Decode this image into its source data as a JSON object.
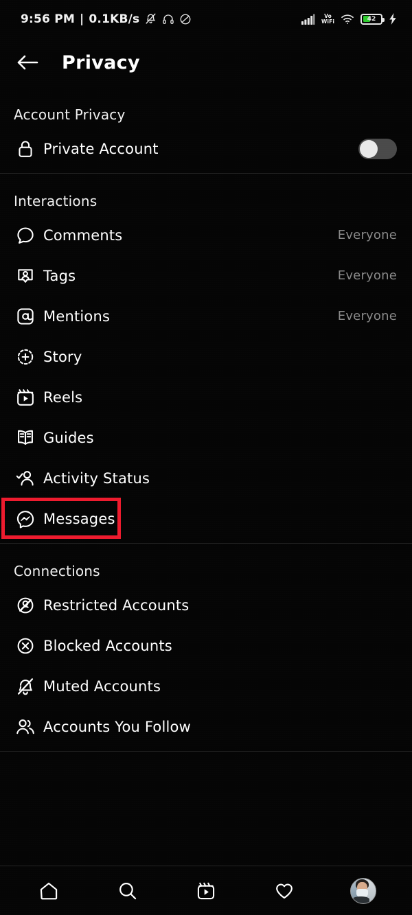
{
  "statusbar": {
    "time": "9:56 PM",
    "separator": "|",
    "network_speed": "0.1KB/s",
    "icons_left": [
      "mute-icon",
      "headphones-icon",
      "dnd-icon"
    ],
    "signal_icon": "signal-bars-icon",
    "vowifi_line1": "Vo",
    "vowifi_line2": "WiFi",
    "wifi_icon": "wifi-icon",
    "battery_percent": "42",
    "battery_level": 42,
    "battery_color": "#2ecc2e",
    "charging_icon": "charging-bolt-icon"
  },
  "header": {
    "back_icon": "back-arrow-icon",
    "title": "Privacy"
  },
  "sections": [
    {
      "title": "Account Privacy",
      "rows": [
        {
          "icon": "lock-icon",
          "label": "Private Account",
          "control": "toggle",
          "toggle_on": false
        }
      ]
    },
    {
      "title": "Interactions",
      "rows": [
        {
          "icon": "comment-icon",
          "label": "Comments",
          "value": "Everyone"
        },
        {
          "icon": "tag-icon",
          "label": "Tags",
          "value": "Everyone"
        },
        {
          "icon": "mention-icon",
          "label": "Mentions",
          "value": "Everyone"
        },
        {
          "icon": "story-plus-icon",
          "label": "Story",
          "value": ""
        },
        {
          "icon": "reels-icon",
          "label": "Reels",
          "value": ""
        },
        {
          "icon": "guides-icon",
          "label": "Guides",
          "value": ""
        },
        {
          "icon": "activity-status-icon",
          "label": "Activity Status",
          "value": ""
        },
        {
          "icon": "messenger-icon",
          "label": "Messages",
          "value": "",
          "highlighted": true
        }
      ]
    },
    {
      "title": "Connections",
      "rows": [
        {
          "icon": "restricted-icon",
          "label": "Restricted Accounts",
          "value": ""
        },
        {
          "icon": "blocked-icon",
          "label": "Blocked Accounts",
          "value": ""
        },
        {
          "icon": "muted-bell-icon",
          "label": "Muted Accounts",
          "value": ""
        },
        {
          "icon": "accounts-you-follow-icon",
          "label": "Accounts You Follow",
          "value": ""
        }
      ]
    }
  ],
  "highlight": {
    "color": "#ee1b2e",
    "target_label": "Messages"
  },
  "bottomnav": {
    "items": [
      {
        "icon": "home-icon",
        "name": "nav-home"
      },
      {
        "icon": "search-icon",
        "name": "nav-search"
      },
      {
        "icon": "reels-icon",
        "name": "nav-reels"
      },
      {
        "icon": "heart-icon",
        "name": "nav-activity"
      },
      {
        "icon": "profile-avatar",
        "name": "nav-profile"
      }
    ]
  }
}
